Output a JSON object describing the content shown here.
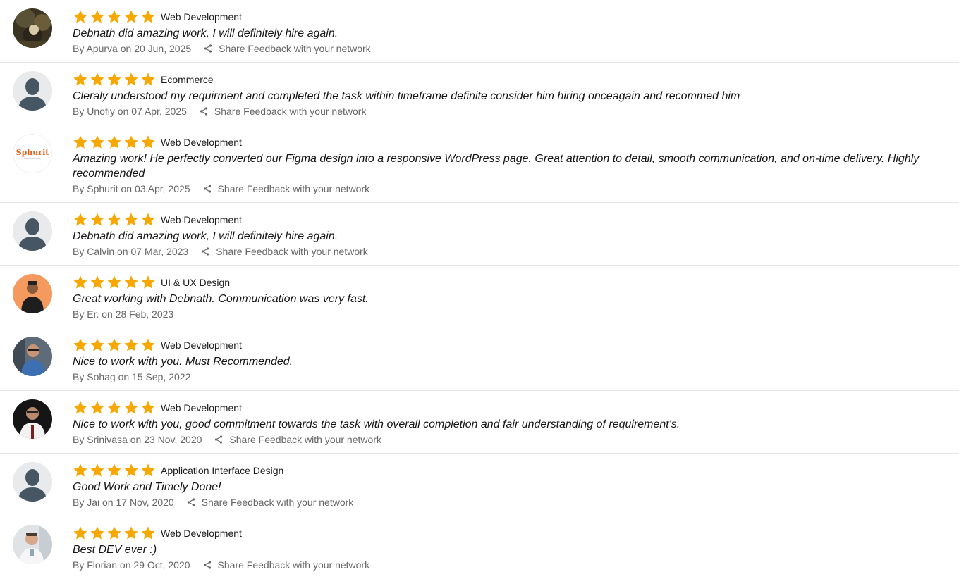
{
  "colors": {
    "star": "#f6a800",
    "meta_text": "#666666",
    "divider": "#e7e7e7"
  },
  "reviews": [
    {
      "rating": 5,
      "category": "Web Development",
      "comment": "Debnath did amazing work, I will definitely hire again.",
      "byline": "By Apurva on 20 Jun, 2025",
      "share_label": "Share Feedback with your network",
      "avatar": "photo-outdoor-icon"
    },
    {
      "rating": 5,
      "category": "Ecommerce",
      "comment": "Cleraly understood my requirment and completed the task within timeframe definite consider him hiring onceagain and recommed him",
      "byline": "By Unofiy on 07 Apr, 2025",
      "share_label": "Share Feedback with your network",
      "avatar": "default-user-icon"
    },
    {
      "rating": 5,
      "category": "Web Development",
      "comment": "Amazing work! He perfectly converted our Figma design into a responsive WordPress page. Great attention to detail, smooth communication, and on-time delivery. Highly recommended",
      "byline": "By Sphurit on 03 Apr, 2025",
      "share_label": "Share Feedback with your network",
      "avatar": "sphurit-logo",
      "logo_text": "Sphurit"
    },
    {
      "rating": 5,
      "category": "Web Development",
      "comment": "Debnath did amazing work, I will definitely hire again.",
      "byline": "By Calvin on 07 Mar, 2023",
      "share_label": "Share Feedback with your network",
      "avatar": "default-user-icon"
    },
    {
      "rating": 5,
      "category": "UI & UX Design",
      "comment": "Great working with Debnath. Communication was very fast.",
      "byline": "By Er. on 28 Feb, 2023",
      "share_label": "",
      "avatar": "photo-orange-icon"
    },
    {
      "rating": 5,
      "category": "Web Development",
      "comment": "Nice to work with you. Must Recommended.",
      "byline": "By Sohag on 15 Sep, 2022",
      "share_label": "",
      "avatar": "photo-sunglasses-icon"
    },
    {
      "rating": 5,
      "category": "Web Development",
      "comment": "Nice to work with you, good commitment towards the task with overall completion and fair understanding of requirement's.",
      "byline": "By Srinivasa on 23 Nov, 2020",
      "share_label": "Share Feedback with your network",
      "avatar": "photo-suit-icon"
    },
    {
      "rating": 5,
      "category": "Application Interface Design",
      "comment": "Good Work and Timely Done!",
      "byline": "By Jai on 17 Nov, 2020",
      "share_label": "Share Feedback with your network",
      "avatar": "default-user-icon"
    },
    {
      "rating": 5,
      "category": "Web Development",
      "comment": "Best DEV ever :)",
      "byline": "By Florian on 29 Oct, 2020",
      "share_label": "Share Feedback with your network",
      "avatar": "photo-office-icon"
    }
  ]
}
